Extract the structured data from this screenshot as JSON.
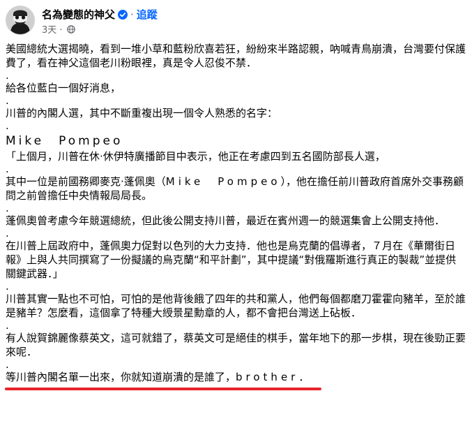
{
  "author": {
    "name": "名為變態的神父",
    "follow_label": "追蹤",
    "separator": "·",
    "timestamp": "3天",
    "timestamp_sep": "·"
  },
  "post": {
    "p1": "美國總統大選揭曉，看到一堆小草和藍粉欣喜若狂，紛紛來半路認親，吶喊青鳥崩潰，台灣要付保護費了，看在神父這個老川粉眼裡，真是令人忍俊不禁．",
    "dot": ".",
    "p2": "給各位藍白一個好消息，",
    "p3": "川普的內閣人選，其中不斷重複出現一個令人熟悉的名字：",
    "p4": "Mike　Pompeo",
    "p5": "「上個月，川普在休·休伊特廣播節目中表示，他正在考慮四到五名國防部長人選，",
    "p6a": "其中一位是前國務卿麥克·蓬佩奧（",
    "p6b": "Mike　Pompeo",
    "p6c": "），他在擔任前川普政府首席外交事務顧問之前曾擔任中央情報局局長。",
    "p7": "蓬佩奧曾考慮今年競選總統，但此後公開支持川普，最近在賓州週一的競選集會上公開支持他．",
    "p8": "在川普上屆政府中，蓬佩奧力促對以色列的大力支持．他也是烏克蘭的倡導者，７月在《華爾街日報》上與人共同撰寫了一份擬議的烏克蘭“和平計劃”，其中提議“對俄羅斯進行真正的製裁”並提供關鍵武器．」",
    "p9": "川普其實一點也不可怕，可怕的是他背後餓了四年的共和黨人，他們每個都磨刀霍霍向豬羊，至於誰是豬羊？怎麼看，這個拿了特種大綬景星勳章的人，都不會把台灣送上砧板．",
    "p10": "有人說賀錦麗像蔡英文，這可就錯了，蔡英文可是絕佳的棋手，當年地下的那一步棋，現在後勁正要來呢．",
    "p11a": "等川普內閣名單一出來，你就知道崩潰的是誰了，",
    "p11b": "brother",
    "p11c": "．"
  },
  "colors": {
    "link": "#0866ff",
    "verified": "#0866ff",
    "underline": "#e8232a",
    "meta": "#65676b"
  },
  "icons": [
    "avatar",
    "verified-badge-icon",
    "globe-icon"
  ]
}
